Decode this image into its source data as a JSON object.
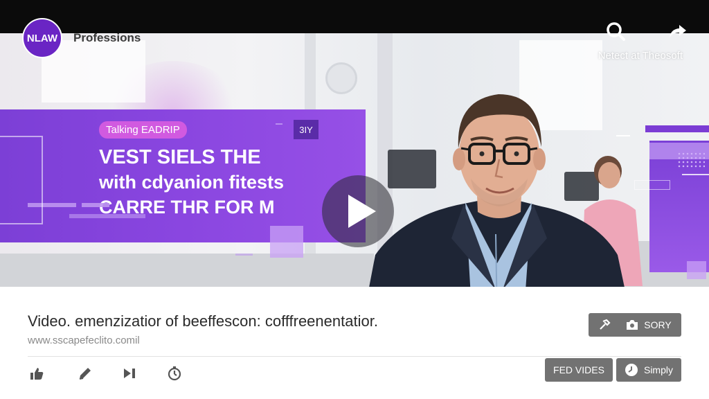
{
  "brand": {
    "logo_text": "NLAW",
    "name": "Professions"
  },
  "top_actions": {
    "search_icon": "search-icon",
    "share_icon": "share-icon",
    "caption": "Netect at Theosoft"
  },
  "video": {
    "banner": {
      "pill": "Talking EADRIP",
      "line1": "VEST SIELS THE",
      "line2": "with cdyanion fitests",
      "line3": "CARRE THR FOR M"
    },
    "tag": "3IY",
    "play_icon": "play-icon"
  },
  "info": {
    "title": "Video. emenzizatior of beeffescon: cofffreenentatior.",
    "url": "www.sscapefeclito.comil"
  },
  "actions": {
    "icons": [
      "like-icon",
      "edit-icon",
      "skip-icon",
      "timer-icon"
    ],
    "sory_label": "SORY",
    "fed_label": "FED VIDES",
    "simply_label": "Simply"
  },
  "colors": {
    "brand_purple": "#6a25c4",
    "banner_purple": "#8a46e0",
    "button_gray": "#727272",
    "topbar": "#0b0b0b"
  }
}
